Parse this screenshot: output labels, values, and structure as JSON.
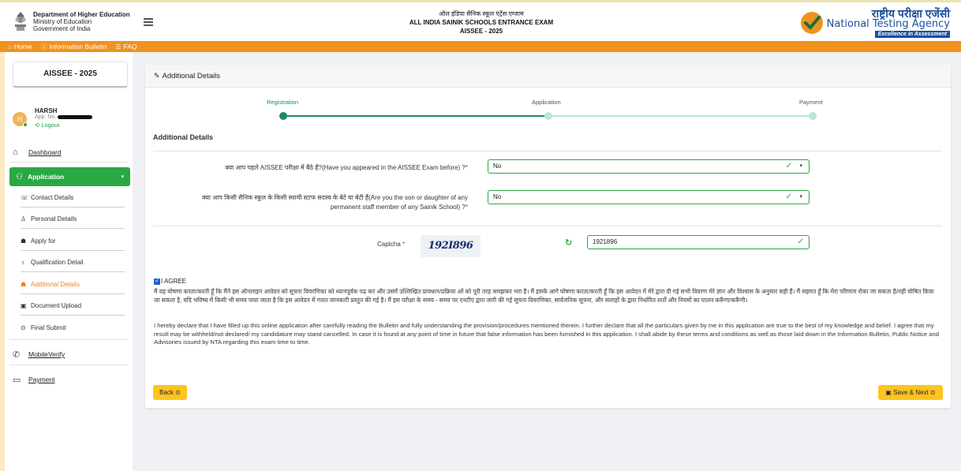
{
  "header": {
    "dept_line1": "Department of Higher Education",
    "dept_line2": "Ministry of Education",
    "dept_line3": "Government of India",
    "title_hindi": "ऑल इंडिया सैनिक स्कूल एंट्रेंस एग्जाम",
    "title_english": "ALL INDIA SAINIK SCHOOLS ENTRANCE EXAM",
    "title_code": "AISSEE - 2025",
    "nta_hindi": "राष्ट्रीय परीक्षा एजेंसी",
    "nta_english": "National Testing Agency",
    "nta_tagline": "Excellence in Assessment"
  },
  "nav": {
    "home": "Home",
    "info_bulletin": "Information Bulletin",
    "faq": "FAQ"
  },
  "sidebar": {
    "exam_title": "AISSEE - 2025",
    "user_name": "HARSH",
    "app_no_label": "App. No.",
    "logout": "Logout",
    "dashboard": "Dashboard",
    "application": "Application",
    "sub_items": [
      "Contact Details",
      "Personal Details",
      "Apply for",
      "Qualification Detail",
      "Additional Details",
      "Document Upload",
      "Final Submit"
    ],
    "active_sub": "Additional Details",
    "mobile_verify": "MobileVerify",
    "payment": "Payment"
  },
  "card": {
    "heading": "Additional Details",
    "steps": [
      "Registration",
      "Application",
      "Payment"
    ],
    "section_title": "Additional Details",
    "q1_label": "क्या आप पहले AISSEE परीक्षा में बैठे हैं?(Have you appeared in the AISSEE Exam before) ?",
    "q1_value": "No",
    "q2_label_line1": "क्या आप किसी सैनिक स्कूल के किसी स्थायी स्टाफ सदस्य के बेटे या बेटी हैं(Are you the son or daughter of any",
    "q2_label_line2": "permanent staff member of any Sainik School) ?",
    "q2_value": "No",
    "captcha_label": "Captcha",
    "captcha_image_text": "192I896",
    "captcha_value": "1921896",
    "agree_label": "I AGREE",
    "decl_hindi": "मैं यह घोषणा करता/करती हूँ कि मैंने इस ऑनलाइन आवेदन को सूचना विवरणिका को ध्यानपूर्वक पढ़ कर और उसमें उल्लिखित प्रावधान/प्रक्रिया ओं को पूरी तरह समझकर भरा है। मैं इसके आगे घोषणा करता/करती हूँ कि इस आवेदन में मेरे द्वारा दी गई सभी विवरण मेरे ज्ञान और विश्वास के अनुसार सही हैं। मैं सहमत हूँ कि मेरा परिणाम रोका जा सकता है/नहीं घोषित किया जा सकता है, यदि भविष्य में किसी भी समय पाया जाता है कि इस आवेदन में गलत जानकारी प्रस्तुत की गई है। मैं इस परीक्षा के समय - समय पर एनटीए द्वारा जारी की गई सूचना विवरणिका, सार्वजनिक सूचना, और सलाहों के द्वारा निर्धारित शर्तों और नियमों का पालन करूँगा/करूँगी।",
    "decl_english": "I hereby declare that I have filled up this online application after carefully reading the Bulletin and fully understanding the provision/procedures mentioned therein. I further declare that all the particulars given by me in this application are true to the best of my knowledge and belief. I agree that my result may be withheld/not declared/ my candidature may stand cancelled. In case it is found at any point of time in future that false information has been furnished in this application. I shall abide by these terms and conditions as well as those laid down in the Information Bulletin, Public Notice and Advisories issued by NTA regarding this exam time to time.",
    "back_button": "Back",
    "save_next_button": "Save & Next"
  },
  "colors": {
    "nav_orange": "#f0921e",
    "sidebar_green": "#2aa844",
    "step_teal": "#1b8a6b",
    "button_yellow": "#ffc41f",
    "nta_blue": "#1e4fa0"
  },
  "icons": [
    "home-icon",
    "info-icon",
    "faq-icon",
    "menu-icon",
    "dashboard-icon",
    "user-add-icon",
    "phone-icon",
    "person-icon",
    "ribbon-icon",
    "education-icon",
    "document-icon",
    "check-circle-icon",
    "mobile-icon",
    "card-icon",
    "edit-icon",
    "refresh-icon",
    "logout-icon"
  ]
}
